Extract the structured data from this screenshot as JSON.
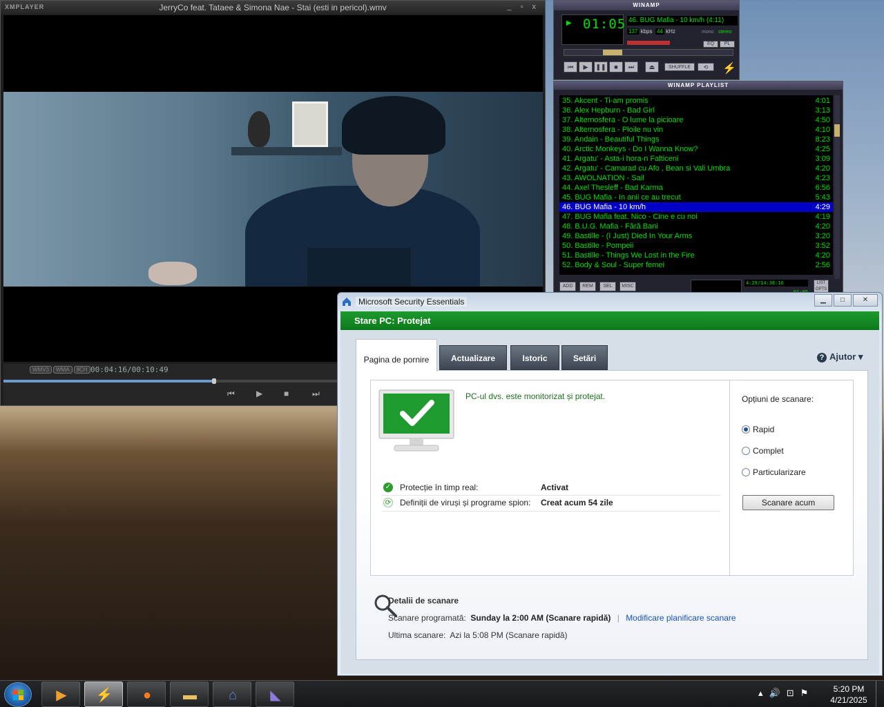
{
  "xmplayer": {
    "logo": "XMPLAYER",
    "title": "JerryCo feat. Tataee & Simona Nae - Stai (esti in pericol).wmv",
    "title_buttons": "_ ▫ x",
    "format_tags": [
      "WMV3",
      "WMA",
      "8CH"
    ],
    "time": "00:04:16/00:10:49",
    "progress": 0.39,
    "controls": {
      "prev": "⏮",
      "play": "▶",
      "stop": "■",
      "next": "⏭"
    }
  },
  "winamp": {
    "title": "WINAMP",
    "clock": "01:05",
    "song": "46. BUG Mafia - 10 km/h (4:11)",
    "kbps": "137",
    "kbps_label": "kbps",
    "khz": "44",
    "khz_label": "kHz",
    "mono": "mono",
    "stereo": "stereo",
    "eq": "EQ",
    "pl": "PL",
    "shuffle": "SHUFFLE",
    "repeat": "⟲",
    "buttons": {
      "prev": "⏮",
      "play": "▶",
      "pause": "❚❚",
      "stop": "■",
      "next": "⏭",
      "eject": "⏏"
    }
  },
  "playlist": {
    "title": "WINAMP PLAYLIST",
    "items": [
      {
        "label": "35. Akcent - Ti-am promis",
        "time": "4:01"
      },
      {
        "label": "36. Alex Hepburn - Bad Girl",
        "time": "3:13"
      },
      {
        "label": "37. Alternosfera - O lume la picioare",
        "time": "4:50"
      },
      {
        "label": "38. Alternosfera - Ploile nu vin",
        "time": "4:10"
      },
      {
        "label": "39. Andain - Beautiful Things",
        "time": "8:23"
      },
      {
        "label": "40. Arctic Monkeys - Do I Wanna Know?",
        "time": "4:25"
      },
      {
        "label": "41. Argatu' - Asta-i hora-n Falticeni",
        "time": "3:09"
      },
      {
        "label": "42. Argatu' - Camarad cu Afo , Bean si Vali Umbra",
        "time": "4:20"
      },
      {
        "label": "43. AWOLNATION - Sail",
        "time": "4:23"
      },
      {
        "label": "44. Axel Thesleff - Bad Karma",
        "time": "6:56"
      },
      {
        "label": "45. BUG Mafia - In anii ce au trecut",
        "time": "5:43"
      },
      {
        "label": "46. BUG Mafia - 10 km/h",
        "time": "4:29"
      },
      {
        "label": "47. BUG Mafia feat. Nico - Cine e cu noi",
        "time": "4:19"
      },
      {
        "label": "48. B.U.G. Mafia - Fără Bani",
        "time": "4:20"
      },
      {
        "label": "49. Bastille - (I Just) Died In Your Arms",
        "time": "3:20"
      },
      {
        "label": "50. Bastille - Pompeii",
        "time": "3:52"
      },
      {
        "label": "51. Bastille - Things We Lost in the Fire",
        "time": "4:20"
      },
      {
        "label": "52. Body & Soul - Super femei",
        "time": "2:56"
      }
    ],
    "selected_index": 11,
    "buttons": [
      "ADD",
      "REM",
      "SEL",
      "MISC"
    ],
    "total_time": "4:29/14:38:16",
    "mini_time": "01:05",
    "list_opts": "LIST OPTS"
  },
  "mse": {
    "title": "Microsoft Security Essentials",
    "status": "Stare PC: Protejat",
    "tabs": [
      "Pagina de pornire",
      "Actualizare",
      "Istoric",
      "Setări"
    ],
    "help": "Ajutor",
    "message": "PC-ul dvs. este monitorizat și protejat.",
    "realtime_label": "Protecție în timp real:",
    "realtime_value": "Activat",
    "defs_label": "Definiții de viruși și programe spion:",
    "defs_value": "Creat acum 54 zile",
    "scan_options_label": "Opțiuni de scanare:",
    "scan_options": [
      "Rapid",
      "Complet",
      "Particularizare"
    ],
    "selected_option": "Rapid",
    "scan_button": "Scanare acum",
    "details_title": "Detalii de scanare",
    "scheduled_label": "Scanare programată:",
    "scheduled_value": "Sunday la 2:00 AM (Scanare rapidă)",
    "scheduled_link": "Modificare planificare scanare",
    "last_scan_label": "Ultima scanare:",
    "last_scan_value": "Azi la 5:08 PM (Scanare rapidă)",
    "accent": "#1e9a2e"
  },
  "taskbar": {
    "time": "5:20 PM",
    "date": "4/21/2025",
    "apps": [
      "windows-media-player",
      "winamp",
      "firefox",
      "file-explorer",
      "microsoft-security-essentials",
      "xmplayer"
    ],
    "active_app": "winamp"
  }
}
